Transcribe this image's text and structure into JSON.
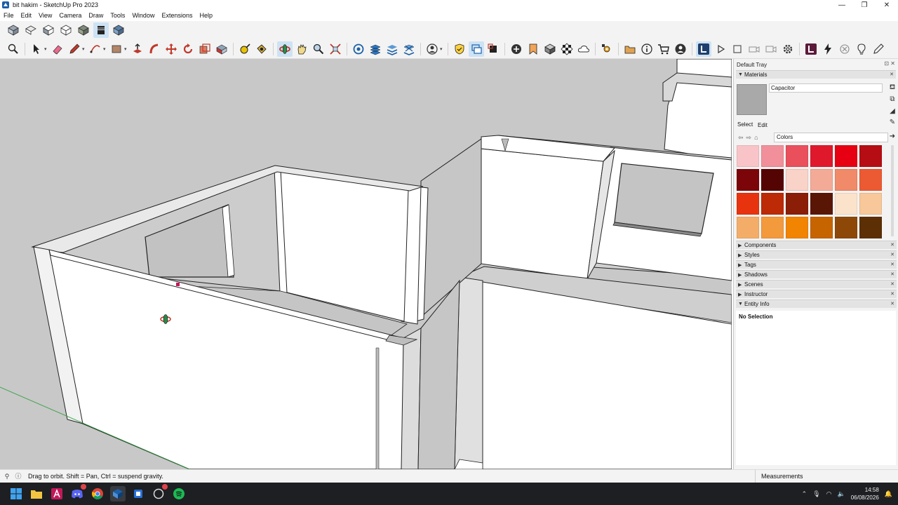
{
  "window": {
    "title": "bit hakim - SketchUp Pro 2023",
    "controls": [
      "minimize",
      "restore",
      "close"
    ]
  },
  "menu": [
    "File",
    "Edit",
    "View",
    "Camera",
    "Draw",
    "Tools",
    "Window",
    "Extensions",
    "Help"
  ],
  "toolbar_views": [
    "iso-view-icon",
    "top-view-icon",
    "front-view-icon",
    "right-view-icon",
    "back-view-icon",
    "left-view-icon",
    "bottom-view-icon"
  ],
  "tray": {
    "title": "Default Tray",
    "materials": {
      "panel_title": "Materials",
      "material_name": "Capacitor",
      "tabs": [
        "Select",
        "Edit"
      ],
      "library": "Colors",
      "swatches": [
        "#f8c4c8",
        "#f1909a",
        "#ea4f5c",
        "#e0182c",
        "#e60012",
        "#b50d13",
        "#7b0508",
        "#540402",
        "#f9d2c8",
        "#f3ab97",
        "#f08a68",
        "#ec5a34",
        "#e8340e",
        "#bc2a06",
        "#8a1e06",
        "#5a1605",
        "#fbe3cb",
        "#f8c89a",
        "#f4ad68",
        "#f39a3c",
        "#f18400",
        "#c66400",
        "#8d4808",
        "#5c2f05"
      ]
    },
    "panels": [
      "Components",
      "Styles",
      "Tags",
      "Shadows",
      "Scenes",
      "Instructor",
      "Entity Info"
    ],
    "entity_info": "No Selection"
  },
  "status": {
    "hint": "Drag to orbit. Shift = Pan, Ctrl = suspend gravity.",
    "measurements_label": "Measurements"
  },
  "taskbar": {
    "time": "14:58",
    "date": "06/08/2026"
  }
}
